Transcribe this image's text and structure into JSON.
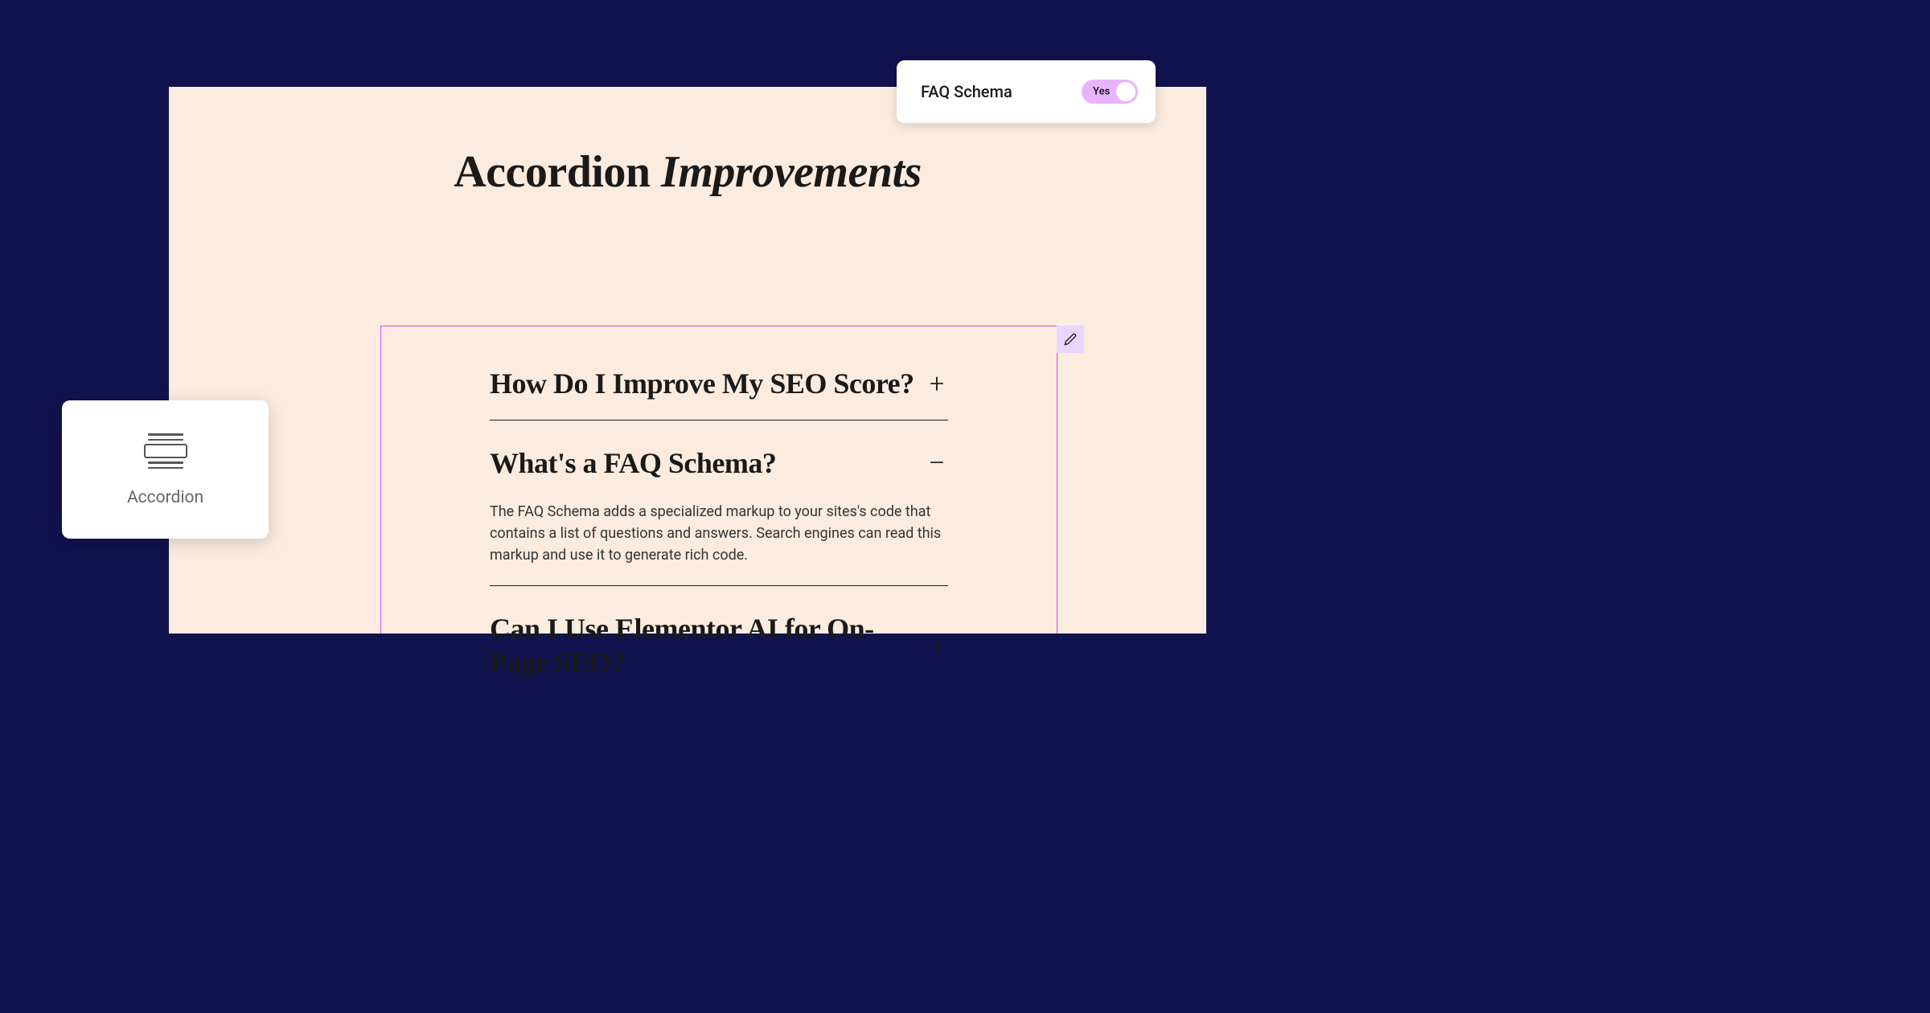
{
  "page": {
    "title_plain": "Accordion ",
    "title_italic": "Improvements"
  },
  "faq_card": {
    "label": "FAQ Schema",
    "toggle_state": "Yes"
  },
  "widget_card": {
    "label": "Accordion"
  },
  "accordion": {
    "items": [
      {
        "title": "How Do I Improve My SEO Score?",
        "expanded": false,
        "toggle": "+"
      },
      {
        "title": "What's a FAQ Schema?",
        "expanded": true,
        "toggle": "–",
        "content": "The FAQ Schema adds a specialized markup to your sites's code that contains a list of questions and answers. Search engines can read this markup and use it to generate rich code."
      },
      {
        "title": "Can I Use Elementor AI for On-Page SEO?",
        "expanded": false,
        "toggle": "+"
      }
    ]
  }
}
